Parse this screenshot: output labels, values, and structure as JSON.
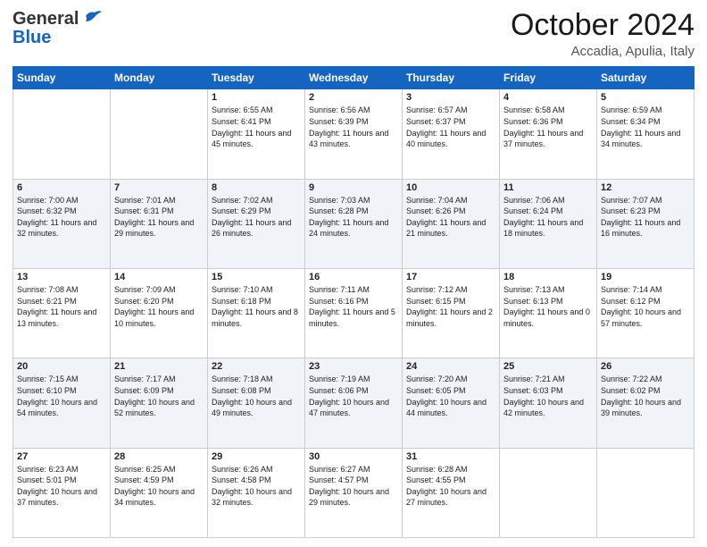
{
  "header": {
    "logo_general": "General",
    "logo_blue": "Blue",
    "month_title": "October 2024",
    "location": "Accadia, Apulia, Italy"
  },
  "weekdays": [
    "Sunday",
    "Monday",
    "Tuesday",
    "Wednesday",
    "Thursday",
    "Friday",
    "Saturday"
  ],
  "weeks": [
    [
      {
        "day": "",
        "info": ""
      },
      {
        "day": "",
        "info": ""
      },
      {
        "day": "1",
        "info": "Sunrise: 6:55 AM\nSunset: 6:41 PM\nDaylight: 11 hours and 45 minutes."
      },
      {
        "day": "2",
        "info": "Sunrise: 6:56 AM\nSunset: 6:39 PM\nDaylight: 11 hours and 43 minutes."
      },
      {
        "day": "3",
        "info": "Sunrise: 6:57 AM\nSunset: 6:37 PM\nDaylight: 11 hours and 40 minutes."
      },
      {
        "day": "4",
        "info": "Sunrise: 6:58 AM\nSunset: 6:36 PM\nDaylight: 11 hours and 37 minutes."
      },
      {
        "day": "5",
        "info": "Sunrise: 6:59 AM\nSunset: 6:34 PM\nDaylight: 11 hours and 34 minutes."
      }
    ],
    [
      {
        "day": "6",
        "info": "Sunrise: 7:00 AM\nSunset: 6:32 PM\nDaylight: 11 hours and 32 minutes."
      },
      {
        "day": "7",
        "info": "Sunrise: 7:01 AM\nSunset: 6:31 PM\nDaylight: 11 hours and 29 minutes."
      },
      {
        "day": "8",
        "info": "Sunrise: 7:02 AM\nSunset: 6:29 PM\nDaylight: 11 hours and 26 minutes."
      },
      {
        "day": "9",
        "info": "Sunrise: 7:03 AM\nSunset: 6:28 PM\nDaylight: 11 hours and 24 minutes."
      },
      {
        "day": "10",
        "info": "Sunrise: 7:04 AM\nSunset: 6:26 PM\nDaylight: 11 hours and 21 minutes."
      },
      {
        "day": "11",
        "info": "Sunrise: 7:06 AM\nSunset: 6:24 PM\nDaylight: 11 hours and 18 minutes."
      },
      {
        "day": "12",
        "info": "Sunrise: 7:07 AM\nSunset: 6:23 PM\nDaylight: 11 hours and 16 minutes."
      }
    ],
    [
      {
        "day": "13",
        "info": "Sunrise: 7:08 AM\nSunset: 6:21 PM\nDaylight: 11 hours and 13 minutes."
      },
      {
        "day": "14",
        "info": "Sunrise: 7:09 AM\nSunset: 6:20 PM\nDaylight: 11 hours and 10 minutes."
      },
      {
        "day": "15",
        "info": "Sunrise: 7:10 AM\nSunset: 6:18 PM\nDaylight: 11 hours and 8 minutes."
      },
      {
        "day": "16",
        "info": "Sunrise: 7:11 AM\nSunset: 6:16 PM\nDaylight: 11 hours and 5 minutes."
      },
      {
        "day": "17",
        "info": "Sunrise: 7:12 AM\nSunset: 6:15 PM\nDaylight: 11 hours and 2 minutes."
      },
      {
        "day": "18",
        "info": "Sunrise: 7:13 AM\nSunset: 6:13 PM\nDaylight: 11 hours and 0 minutes."
      },
      {
        "day": "19",
        "info": "Sunrise: 7:14 AM\nSunset: 6:12 PM\nDaylight: 10 hours and 57 minutes."
      }
    ],
    [
      {
        "day": "20",
        "info": "Sunrise: 7:15 AM\nSunset: 6:10 PM\nDaylight: 10 hours and 54 minutes."
      },
      {
        "day": "21",
        "info": "Sunrise: 7:17 AM\nSunset: 6:09 PM\nDaylight: 10 hours and 52 minutes."
      },
      {
        "day": "22",
        "info": "Sunrise: 7:18 AM\nSunset: 6:08 PM\nDaylight: 10 hours and 49 minutes."
      },
      {
        "day": "23",
        "info": "Sunrise: 7:19 AM\nSunset: 6:06 PM\nDaylight: 10 hours and 47 minutes."
      },
      {
        "day": "24",
        "info": "Sunrise: 7:20 AM\nSunset: 6:05 PM\nDaylight: 10 hours and 44 minutes."
      },
      {
        "day": "25",
        "info": "Sunrise: 7:21 AM\nSunset: 6:03 PM\nDaylight: 10 hours and 42 minutes."
      },
      {
        "day": "26",
        "info": "Sunrise: 7:22 AM\nSunset: 6:02 PM\nDaylight: 10 hours and 39 minutes."
      }
    ],
    [
      {
        "day": "27",
        "info": "Sunrise: 6:23 AM\nSunset: 5:01 PM\nDaylight: 10 hours and 37 minutes."
      },
      {
        "day": "28",
        "info": "Sunrise: 6:25 AM\nSunset: 4:59 PM\nDaylight: 10 hours and 34 minutes."
      },
      {
        "day": "29",
        "info": "Sunrise: 6:26 AM\nSunset: 4:58 PM\nDaylight: 10 hours and 32 minutes."
      },
      {
        "day": "30",
        "info": "Sunrise: 6:27 AM\nSunset: 4:57 PM\nDaylight: 10 hours and 29 minutes."
      },
      {
        "day": "31",
        "info": "Sunrise: 6:28 AM\nSunset: 4:55 PM\nDaylight: 10 hours and 27 minutes."
      },
      {
        "day": "",
        "info": ""
      },
      {
        "day": "",
        "info": ""
      }
    ]
  ]
}
